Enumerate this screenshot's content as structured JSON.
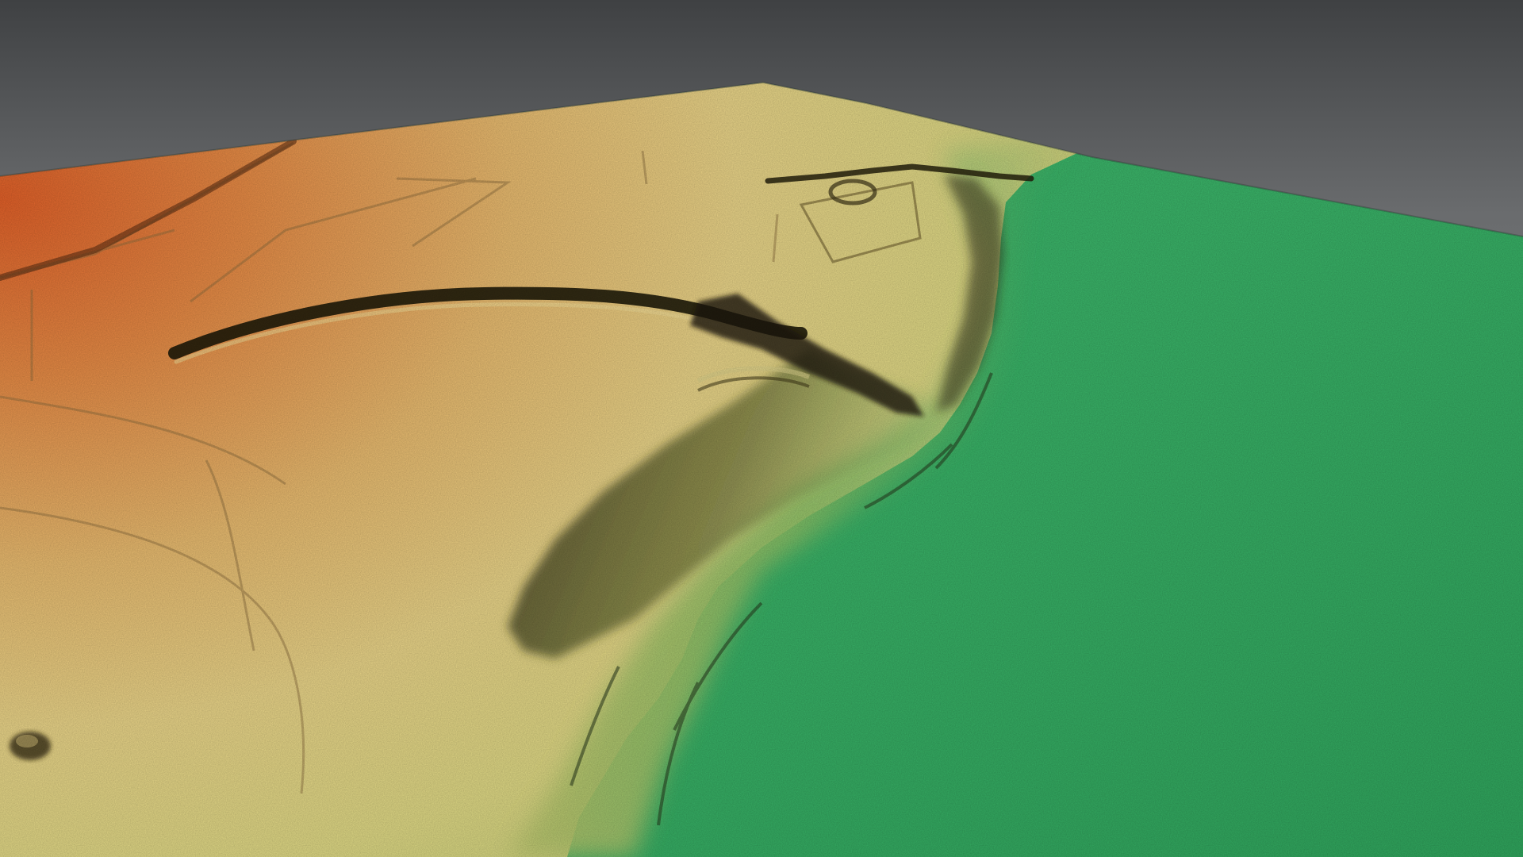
{
  "scene": {
    "background_top": "#414345",
    "background_bottom": "#8a8d8f",
    "elevation_colors": {
      "high": "#e0682f",
      "mid_high": "#e3a55d",
      "mid": "#e6cf84",
      "mid_low": "#cfd27a",
      "transition": "#74b85f",
      "low": "#3db56b",
      "lowest": "#34a85e"
    },
    "shadow_color": "#1a1708",
    "feature_names": [
      "ditch-crest",
      "escarpment",
      "plateau-enclosure",
      "field-boundaries",
      "hollow-ways",
      "floodplain"
    ]
  }
}
